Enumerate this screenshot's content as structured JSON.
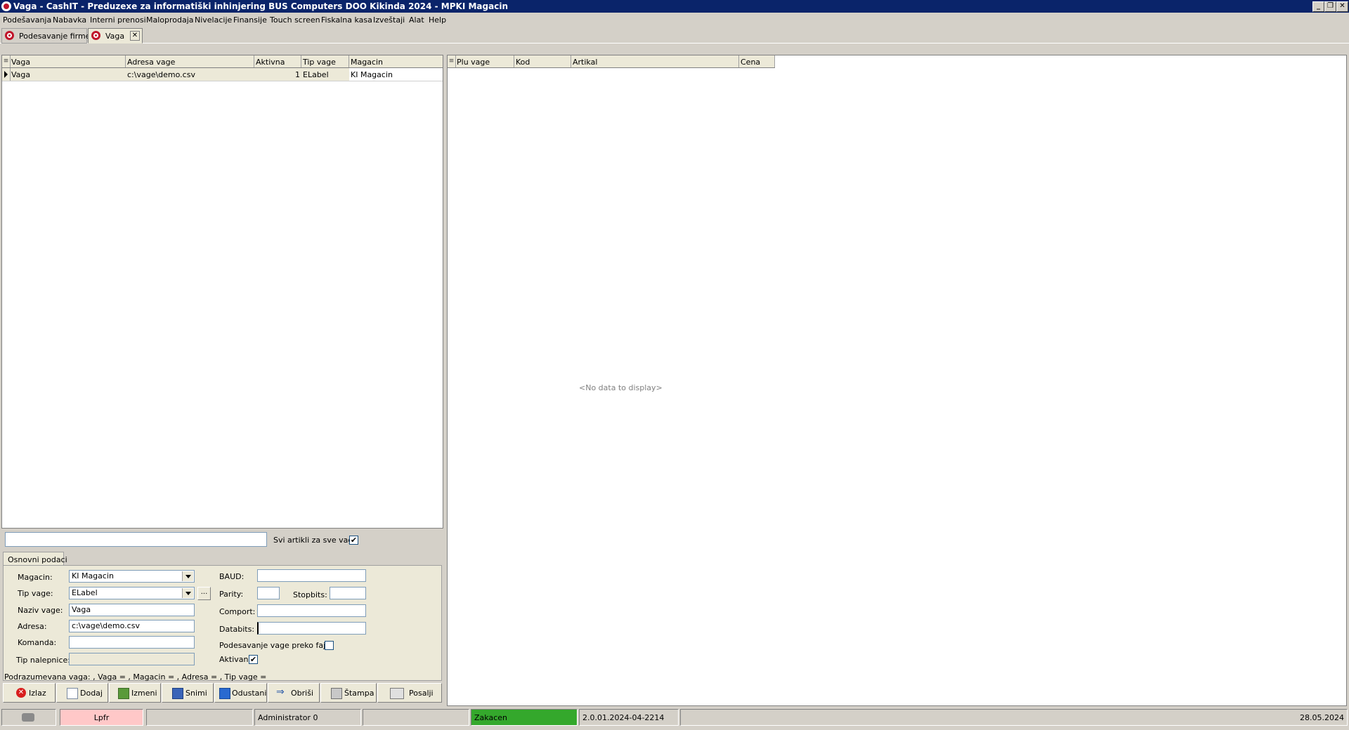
{
  "window": {
    "title": "Vaga - CashIT - Preduzexe za informatiški inhinjering BUS Computers DOO Kikinda 2024 - MPKI Magacin"
  },
  "menu": [
    {
      "label": "Podešavanja"
    },
    {
      "label": "Nabavka"
    },
    {
      "label": "Interni prenosi"
    },
    {
      "label": "Maloprodaja"
    },
    {
      "label": "Nivelacije"
    },
    {
      "label": "Finansije"
    },
    {
      "label": "Touch screen"
    },
    {
      "label": "Fiskalna kasa"
    },
    {
      "label": "Izveštaji"
    },
    {
      "label": "Alat"
    },
    {
      "label": "Help"
    }
  ],
  "tabs": [
    {
      "label": "Podesavanje firme"
    },
    {
      "label": "Vaga"
    }
  ],
  "left_grid": {
    "columns": [
      "Vaga",
      "Adresa vage",
      "Aktivna",
      "Tip vage",
      "Magacin"
    ],
    "rows": [
      [
        "Vaga",
        "c:\\vage\\demo.csv",
        "1",
        "ELabel",
        "KI Magacin"
      ]
    ]
  },
  "right_grid": {
    "columns": [
      "Plu vage",
      "Kod",
      "Artikal",
      "Cena"
    ],
    "empty_text": "<No data to display>"
  },
  "filter": {
    "search_value": "",
    "svi_artikli_label": "Svi artikli za sve vage",
    "svi_artikli_checked": "✔"
  },
  "form": {
    "tab_label": "Osnovni podaci",
    "magacin_label": "Magacin:",
    "magacin_value": "KI Magacin",
    "tip_vage_label": "Tip vage:",
    "tip_vage_value": "ELabel",
    "ellipsis": "...",
    "naziv_label": "Naziv vage:",
    "naziv_value": "Vaga",
    "adresa_label": "Adresa:",
    "adresa_value": "c:\\vage\\demo.csv",
    "komanda_label": "Komanda:",
    "komanda_value": "",
    "tip_nalepnice_label": "Tip nalepnice:",
    "tip_nalepnice_value": "",
    "baud_label": "BAUD:",
    "baud_value": "",
    "parity_label": "Parity:",
    "parity_value": "",
    "stopbits_label": "Stopbits:",
    "stopbits_value": "",
    "comport_label": "Comport:",
    "comport_value": "",
    "databits_label": "Databits:",
    "databits_value": "",
    "fajl_label": "Podesavanje vage preko fajla",
    "fajl_checked": "",
    "aktivan_label": "Aktivan",
    "aktivan_checked": "✔"
  },
  "default_info": "Podrazumevana vaga: ,  Vaga = ,  Magacin = ,  Adresa = ,  Tip vage =",
  "buttons": {
    "izlaz": "Izlaz",
    "dodaj": "Dodaj",
    "izmeni": "Izmeni",
    "snimi": "Snimi",
    "odustani": "Odustani",
    "obrisi": "Obriši",
    "stampa": "Štampa",
    "posalji": "Posalji"
  },
  "status": {
    "lpfr": "Lpfr",
    "user": "Administrator 0",
    "state": "Zakacen",
    "version": "2.0.01.2024-04-2214",
    "date": "28.05.2024"
  },
  "colors": {
    "title_bar": "#0a246a",
    "lpfr_bg": "#ffc8c8",
    "zakacen_bg": "#34a82c",
    "logo_red": "#c0142a"
  }
}
